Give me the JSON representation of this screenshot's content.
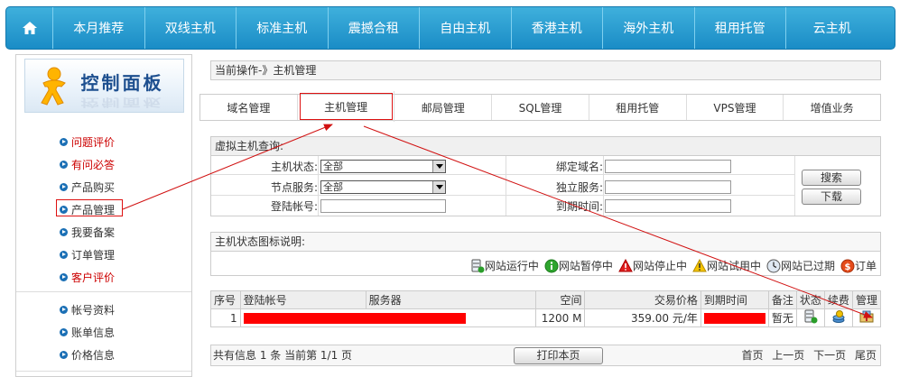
{
  "nav": {
    "items": [
      "本月推荐",
      "双线主机",
      "标准主机",
      "震撼合租",
      "自由主机",
      "香港主机",
      "海外主机",
      "租用托管",
      "云主机"
    ]
  },
  "sidebar": {
    "title": "控制面板",
    "group1": [
      {
        "label": "问题评价",
        "highlight": true
      },
      {
        "label": "有问必答",
        "highlight": true
      },
      {
        "label": "产品购买",
        "highlight": false
      },
      {
        "label": "产品管理",
        "highlight": false
      },
      {
        "label": "我要备案",
        "highlight": false
      },
      {
        "label": "订单管理",
        "highlight": false
      },
      {
        "label": "客户评价",
        "highlight": true
      }
    ],
    "group2": [
      {
        "label": "帐号资料"
      },
      {
        "label": "账单信息"
      },
      {
        "label": "价格信息"
      }
    ]
  },
  "breadcrumb": "当前操作-》主机管理",
  "tabs": [
    "域名管理",
    "主机管理",
    "邮局管理",
    "SQL管理",
    "租用托管",
    "VPS管理",
    "增值业务"
  ],
  "query": {
    "title": "虚拟主机查询:",
    "status_label": "主机状态:",
    "status_value": "全部",
    "node_label": "节点服务:",
    "node_value": "全部",
    "account_label": "登陆帐号:",
    "domain_label": "绑定域名:",
    "dedicated_label": "独立服务:",
    "expire_label": "到期时间:",
    "search_btn": "搜索",
    "download_btn": "下载"
  },
  "legend": {
    "title": "主机状态图标说明:",
    "items": [
      "网站运行中",
      "网站暂停中",
      "网站停止中",
      "网站试用中",
      "网站已过期",
      "订单"
    ]
  },
  "table": {
    "headers": [
      "序号",
      "登陆帐号",
      "服务器",
      "空间",
      "交易价格",
      "到期时间",
      "备注",
      "状态",
      "续费",
      "管理"
    ],
    "rows": [
      {
        "index": "1",
        "space": "1200 M",
        "price": "359.00 元/年",
        "note": "暂无"
      }
    ]
  },
  "footer": {
    "summary": "共有信息 1 条 当前第 1/1 页",
    "print": "打印本页",
    "first": "首页",
    "prev": "上一页",
    "next": "下一页",
    "last": "尾页"
  },
  "colors": {
    "nav_bg": "#1a8cc6",
    "highlight_text": "#cc0000",
    "redaction": "#ff0000",
    "annotation": "#d11111"
  }
}
